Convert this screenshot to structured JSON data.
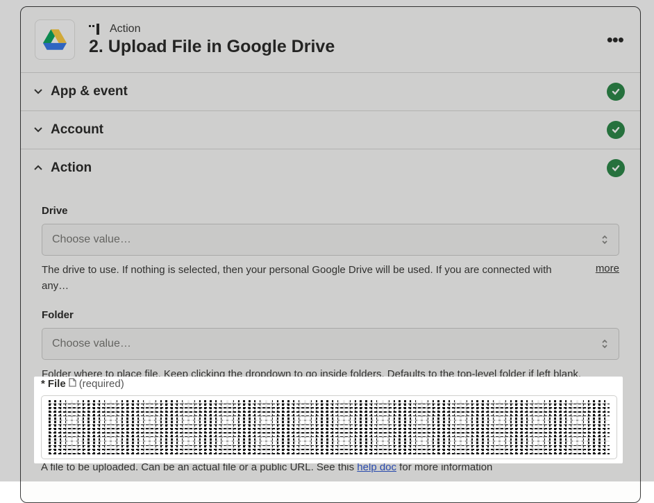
{
  "header": {
    "badge_label": "Action",
    "title": "2. Upload File in Google Drive"
  },
  "sections": {
    "app_event": "App & event",
    "account": "Account",
    "action": "Action"
  },
  "fields": {
    "drive": {
      "label": "Drive",
      "placeholder": "Choose value…",
      "help": "The drive to use. If nothing is selected, then your personal Google Drive will be used. If you are connected with any…",
      "more": "more"
    },
    "folder": {
      "label": "Folder",
      "placeholder": "Choose value…",
      "help": "Folder where to place file. Keep clicking the dropdown to go inside folders. Defaults to the top-level folder if left blank."
    },
    "file": {
      "asterisk": "*",
      "label": "File",
      "required": "(required)",
      "help_pre": "A file to be uploaded. Can be an actual file or a public URL. See this ",
      "help_link": "help doc",
      "help_post": " for more information"
    }
  }
}
